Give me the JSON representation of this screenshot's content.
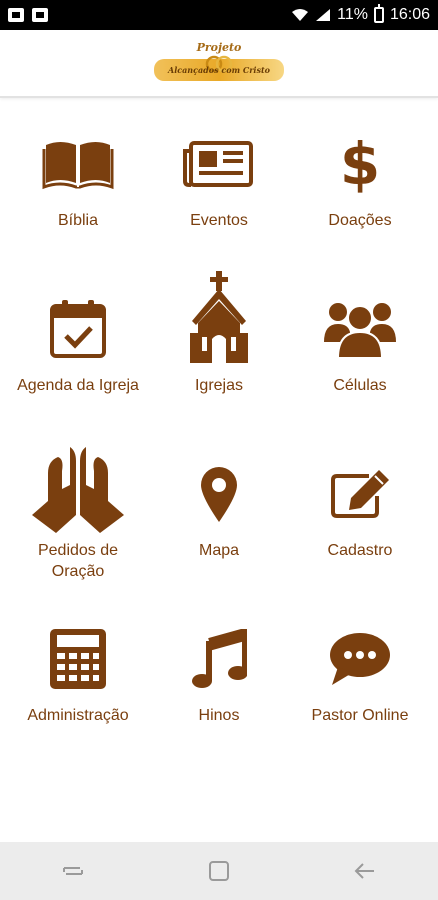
{
  "status_bar": {
    "battery": "11%",
    "time": "16:06"
  },
  "header": {
    "logo_line1": "Projeto",
    "logo_line2": "Alcançados com Cristo"
  },
  "menu": [
    {
      "label": "Bíblia",
      "icon": "book-icon"
    },
    {
      "label": "Eventos",
      "icon": "newspaper-icon"
    },
    {
      "label": "Doações",
      "icon": "dollar-icon"
    },
    {
      "label": "Agenda da Igreja",
      "icon": "calendar-check-icon"
    },
    {
      "label": "Igrejas",
      "icon": "church-icon"
    },
    {
      "label": "Células",
      "icon": "users-icon"
    },
    {
      "label": "Pedidos de\nOração",
      "icon": "praying-hands-icon"
    },
    {
      "label": "Mapa",
      "icon": "map-pin-icon"
    },
    {
      "label": "Cadastro",
      "icon": "edit-icon"
    },
    {
      "label": "Administração",
      "icon": "calculator-icon"
    },
    {
      "label": "Hinos",
      "icon": "music-note-icon"
    },
    {
      "label": "Pastor Online",
      "icon": "chat-bubble-icon"
    }
  ],
  "colors": {
    "accent": "#7a3f0f",
    "header_gold": "#e9a928",
    "nav_bg": "#ececec"
  }
}
